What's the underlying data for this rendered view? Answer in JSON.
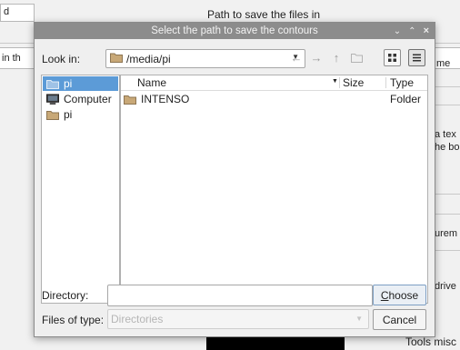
{
  "background": {
    "top_input_text": "d",
    "top_label": "Path to save the files in",
    "left_label": "in th",
    "right_label_1": "me",
    "right_label_2": "a tex",
    "right_label_3": "he bo",
    "right_label_4": "urem",
    "right_label_5": "drive",
    "bottom_label": "Tools misc"
  },
  "dialog": {
    "title": "Select the path to save the contours",
    "window_controls": {
      "minimize": "⌄",
      "maximize": "⌃",
      "close": "×"
    },
    "lookin_label": "Look in:",
    "lookin_value": "/media/pi",
    "nav": {
      "back": "←",
      "forward": "→",
      "up": "↑"
    },
    "sidebar": {
      "items": [
        {
          "label": "pi",
          "icon": "folder-icon"
        },
        {
          "label": "Computer",
          "icon": "computer-icon"
        },
        {
          "label": "pi",
          "icon": "folder-icon"
        }
      ]
    },
    "files": {
      "columns": {
        "name": "Name",
        "size": "Size",
        "type": "Type"
      },
      "rows": [
        {
          "name": "INTENSO",
          "size": "",
          "type": "Folder",
          "icon": "folder-icon"
        }
      ]
    },
    "directory_label": "Directory:",
    "directory_value": "",
    "filetype_label": "Files of type:",
    "filetype_value": "Directories",
    "choose_button_first": "C",
    "choose_button_rest": "hoose",
    "cancel_button": "Cancel"
  },
  "colors": {
    "titlebar": "#8c8c8c",
    "selection": "#5c9bd7",
    "folder": "#c8a877"
  }
}
